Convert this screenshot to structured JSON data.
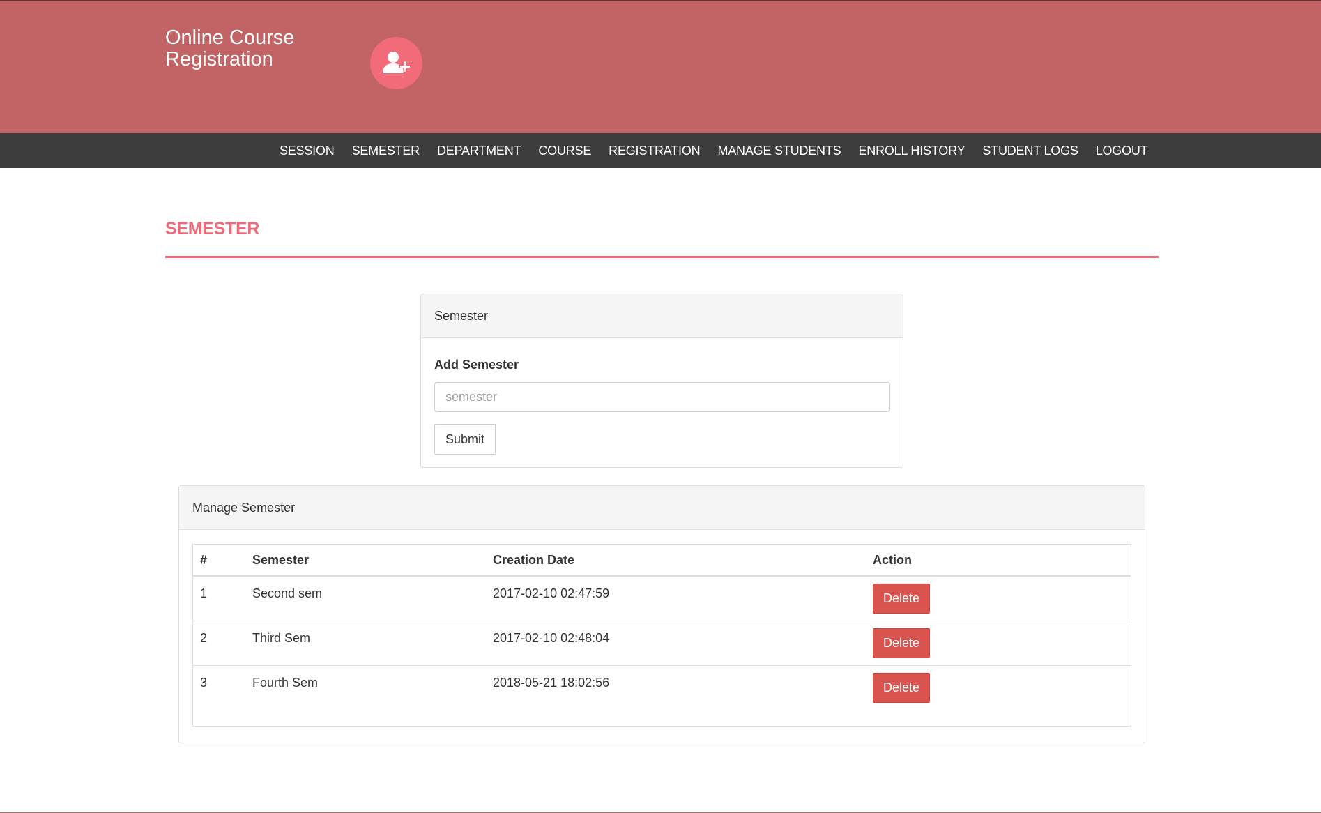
{
  "header": {
    "brand_line1": "Online Course",
    "brand_line2": "Registration",
    "logo_icon": "user-plus-icon",
    "accent_color": "#c26466"
  },
  "nav": {
    "items": [
      "SESSION",
      "SEMESTER",
      "DEPARTMENT",
      "COURSE",
      "REGISTRATION",
      "MANAGE STUDENTS",
      "ENROLL HISTORY",
      "STUDENT LOGS",
      "LOGOUT"
    ]
  },
  "page": {
    "title": "SEMESTER",
    "title_color": "#ef6a78"
  },
  "add_panel": {
    "heading": "Semester",
    "label": "Add Semester",
    "input_value": "",
    "input_placeholder": "semester",
    "submit_label": "Submit"
  },
  "manage_panel": {
    "heading": "Manage Semester",
    "columns": [
      "#",
      "Semester",
      "Creation Date",
      "Action"
    ],
    "rows": [
      {
        "num": "1",
        "semester": "Second sem",
        "date": "2017-02-10 02:47:59",
        "action": "Delete"
      },
      {
        "num": "2",
        "semester": "Third Sem",
        "date": "2017-02-10 02:48:04",
        "action": "Delete"
      },
      {
        "num": "3",
        "semester": "Fourth Sem",
        "date": "2018-05-21 18:02:56",
        "action": "Delete"
      }
    ],
    "delete_color": "#d9534f"
  }
}
